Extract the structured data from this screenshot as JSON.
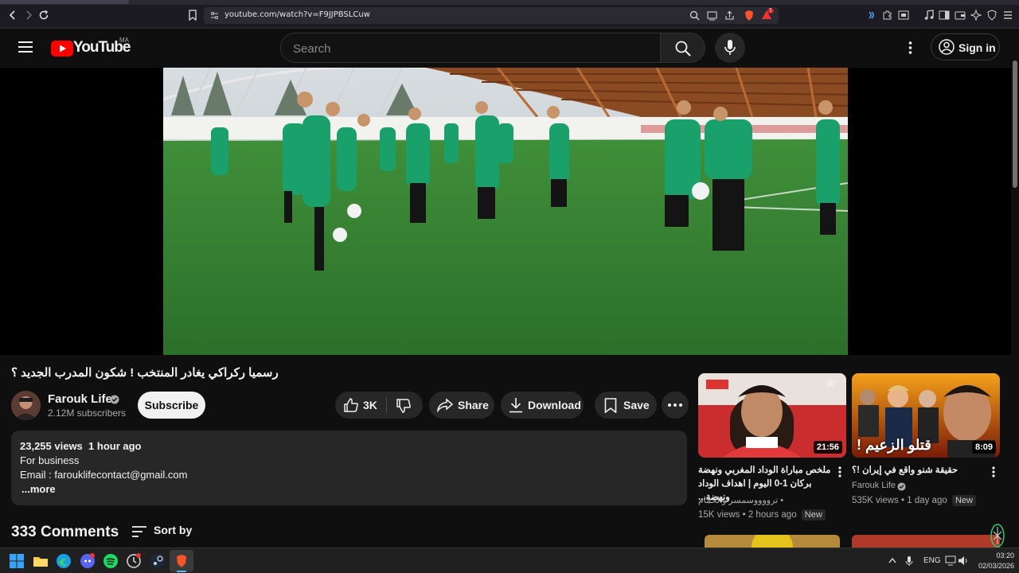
{
  "browser": {
    "url": "youtube.com/watch?v=F9JJPBSLCuw",
    "notification_count": "1"
  },
  "header": {
    "brand": "YouTube",
    "region": "MA",
    "search_placeholder": "Search",
    "sign_in_label": "Sign in"
  },
  "video": {
    "title": "رسميا ركراكي يغادر المنتخب ! شكون المدرب الجديد ؟"
  },
  "channel": {
    "name": "Farouk Life",
    "subscribers": "2.12M subscribers",
    "subscribe_label": "Subscribe"
  },
  "actions": {
    "likes": "3K",
    "share": "Share",
    "download": "Download",
    "save": "Save"
  },
  "description": {
    "views": "23,255 views",
    "time": "1 hour ago",
    "line1": "For business",
    "line2": "Email : farouklifecontact@gmail.com",
    "more": "...more"
  },
  "comments": {
    "count": "333 Comments",
    "sort_label": "Sort by"
  },
  "recommendations": [
    {
      "title": "ملخص مباراة الوداد المغربي ونهضة بركان 1-0 اليوم | اهداف الوداد ونهضة...",
      "channel": "ترووووسمسر والحمام •",
      "views": "15K views",
      "age": "2 hours ago",
      "badge": "New",
      "duration": "21:56"
    },
    {
      "title": "حقيقة شنو واقع في إيران !؟",
      "channel": "Farouk Life",
      "views": "535K views",
      "age": "1 day ago",
      "badge": "New",
      "duration": "8:09",
      "thumb_text": "قتلو الزعيم !"
    }
  ],
  "taskbar": {
    "lang": "ENG",
    "time": "03:20",
    "date": "02/03/2026"
  },
  "colors": {
    "background": "#0f0f0f",
    "brand_red": "#ff0000",
    "pill": "#272727",
    "pitch_green": "#2f7d32"
  }
}
